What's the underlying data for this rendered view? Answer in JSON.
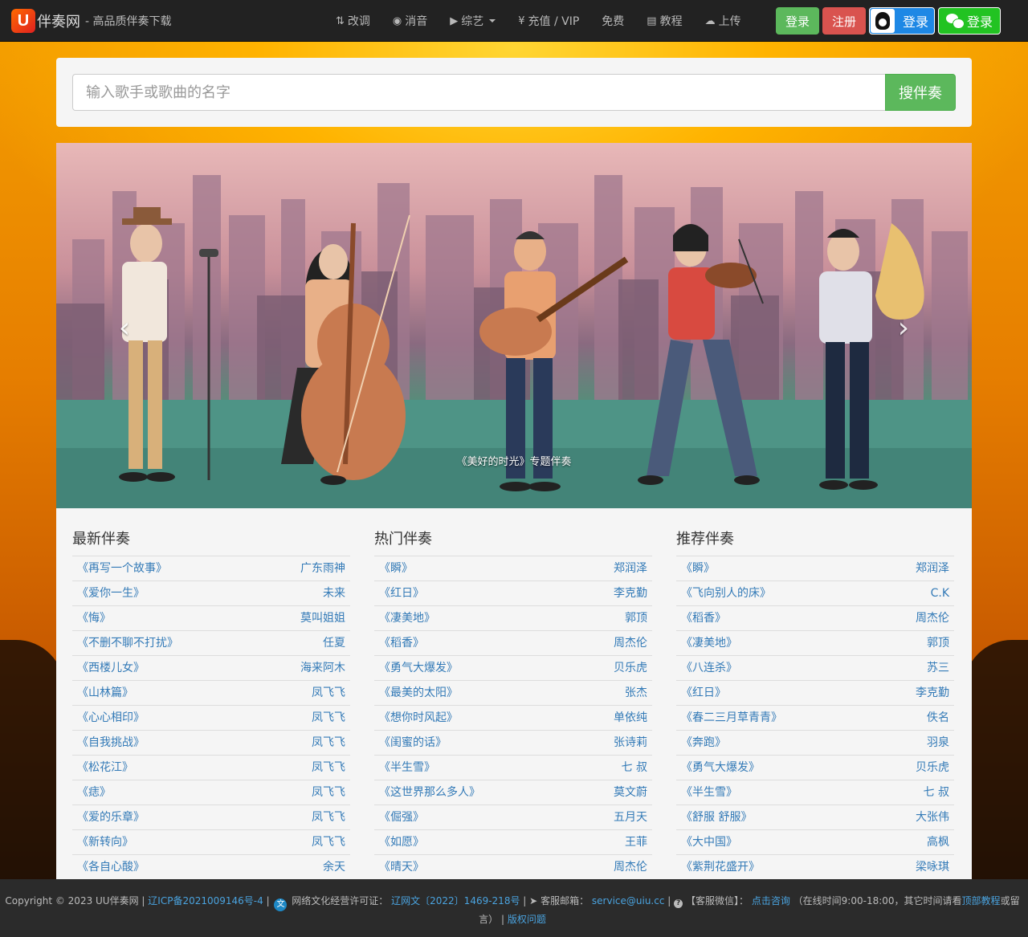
{
  "brand": {
    "logo_text": "U",
    "name": "伴奏网",
    "slogan": "- 高品质伴奏下载"
  },
  "nav": [
    {
      "icon": "sort-icon",
      "glyph": "⇅",
      "label": "改调"
    },
    {
      "icon": "disc-icon",
      "glyph": "◉",
      "label": "消音"
    },
    {
      "icon": "play-icon",
      "glyph": "▶",
      "label": "综艺",
      "dropdown": true
    },
    {
      "icon": "yen-icon",
      "glyph": "¥",
      "label": "充值 / VIP"
    },
    {
      "icon": "",
      "glyph": "",
      "label": "免费"
    },
    {
      "icon": "book-icon",
      "glyph": "▤",
      "label": "教程"
    },
    {
      "icon": "upload-cloud-icon",
      "glyph": "☁",
      "label": "上传"
    }
  ],
  "auth": {
    "login_label": "登录",
    "register_label": "注册",
    "qq_login_label": "登录",
    "wechat_login_label": "登录"
  },
  "search": {
    "placeholder": "输入歌手或歌曲的名字",
    "button_label": "搜伴奏"
  },
  "carousel": {
    "caption": "《美好的时光》专题伴奏",
    "prev_glyph": "‹",
    "next_glyph": "›"
  },
  "lists": [
    {
      "title": "最新伴奏",
      "items": [
        {
          "song": "《再写一个故事》",
          "artist": "广东雨神"
        },
        {
          "song": "《爱你一生》",
          "artist": "未来"
        },
        {
          "song": "《悔》",
          "artist": "莫叫姐姐"
        },
        {
          "song": "《不删不聊不打扰》",
          "artist": "任夏"
        },
        {
          "song": "《西楼儿女》",
          "artist": "海来阿木"
        },
        {
          "song": "《山林篇》",
          "artist": "凤飞飞"
        },
        {
          "song": "《心心相印》",
          "artist": "凤飞飞"
        },
        {
          "song": "《自我挑战》",
          "artist": "凤飞飞"
        },
        {
          "song": "《松花江》",
          "artist": "凤飞飞"
        },
        {
          "song": "《痣》",
          "artist": "凤飞飞"
        },
        {
          "song": "《爱的乐章》",
          "artist": "凤飞飞"
        },
        {
          "song": "《新转向》",
          "artist": "凤飞飞"
        },
        {
          "song": "《各自心酸》",
          "artist": "余天"
        }
      ]
    },
    {
      "title": "热门伴奏",
      "items": [
        {
          "song": "《瞬》",
          "artist": "郑润泽"
        },
        {
          "song": "《红日》",
          "artist": "李克勤"
        },
        {
          "song": "《凄美地》",
          "artist": "郭顶"
        },
        {
          "song": "《稻香》",
          "artist": "周杰伦"
        },
        {
          "song": "《勇气大爆发》",
          "artist": "贝乐虎"
        },
        {
          "song": "《最美的太阳》",
          "artist": "张杰"
        },
        {
          "song": "《想你时风起》",
          "artist": "单依纯"
        },
        {
          "song": "《闺蜜的话》",
          "artist": "张诗莉"
        },
        {
          "song": "《半生雪》",
          "artist": "七 叔"
        },
        {
          "song": "《这世界那么多人》",
          "artist": "莫文蔚"
        },
        {
          "song": "《倔强》",
          "artist": "五月天"
        },
        {
          "song": "《如愿》",
          "artist": "王菲"
        },
        {
          "song": "《晴天》",
          "artist": "周杰伦"
        }
      ]
    },
    {
      "title": "推荐伴奏",
      "items": [
        {
          "song": "《瞬》",
          "artist": "郑润泽"
        },
        {
          "song": "《飞向别人的床》",
          "artist": "C.K"
        },
        {
          "song": "《稻香》",
          "artist": "周杰伦"
        },
        {
          "song": "《凄美地》",
          "artist": "郭顶"
        },
        {
          "song": "《八连杀》",
          "artist": "苏三"
        },
        {
          "song": "《红日》",
          "artist": "李克勤"
        },
        {
          "song": "《春二三月草青青》",
          "artist": "佚名"
        },
        {
          "song": "《奔跑》",
          "artist": "羽泉"
        },
        {
          "song": "《勇气大爆发》",
          "artist": "贝乐虎"
        },
        {
          "song": "《半生雪》",
          "artist": "七 叔"
        },
        {
          "song": "《舒服 舒服》",
          "artist": "大张伟"
        },
        {
          "song": "《大中国》",
          "artist": "高枫"
        },
        {
          "song": "《紫荆花盛开》",
          "artist": "梁咏琪"
        }
      ]
    }
  ],
  "footer": {
    "copyright": "Copyright © 2023 UU伴奏网",
    "icp": "辽ICP备2021009146号-4",
    "culture_label": "网络文化经营许可证：",
    "culture_license": "辽网文〔2022〕1469-218号",
    "email_label": "客服邮箱：",
    "email": "service@uiu.cc",
    "wechat_label": "【客服微信】：",
    "consult_link": "点击咨询",
    "hours_note": "（在线时间9:00-18:00，其它时间请看",
    "tutorial_link": "顶部教程",
    "hours_suffix": "或留言）",
    "copyright_issue_link": "版权问题",
    "sep": "|"
  }
}
